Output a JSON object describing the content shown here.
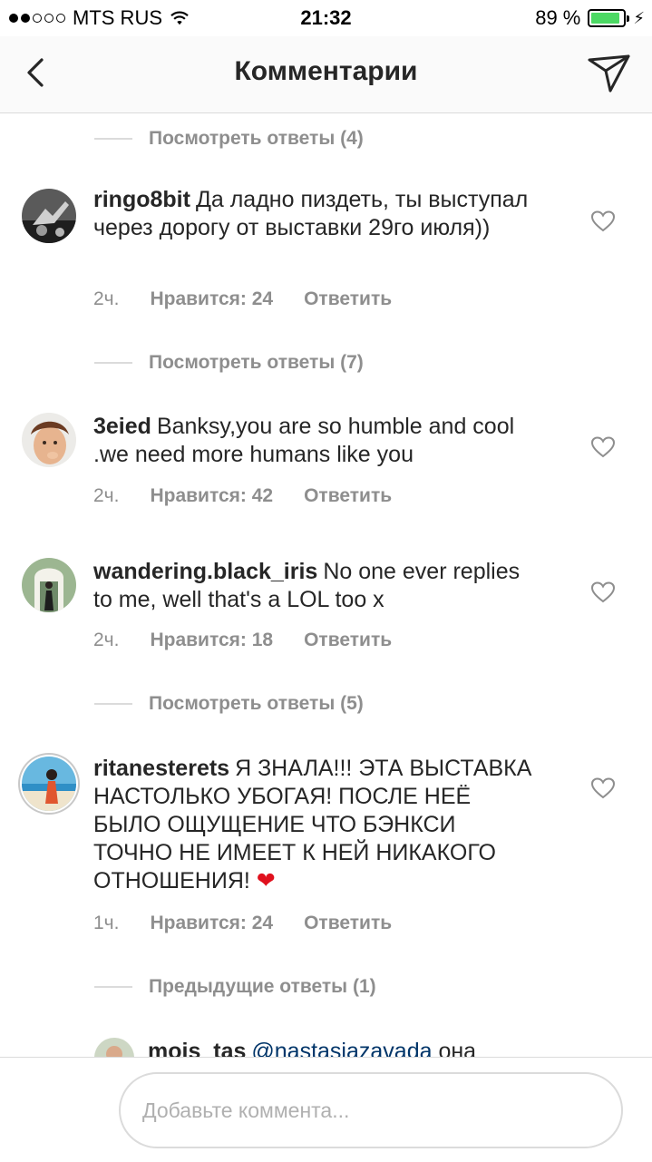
{
  "status_bar": {
    "carrier": "MTS RUS",
    "time": "21:32",
    "battery_percent": "89 %",
    "battery_level": 0.89,
    "signal_bars_filled": 2,
    "signal_bars_total": 5
  },
  "header": {
    "title": "Комментарии",
    "back_icon": "chevron-left-icon",
    "action_icon": "send-icon"
  },
  "threads": [
    {
      "view_replies_label": "Посмотреть ответы (4)"
    },
    {
      "username": "ringo8bit",
      "text": "Да ладно пиздеть, ты выступал через дорогу от выставки 29го июля))",
      "time": "2ч.",
      "likes": "Нравится: 24",
      "reply": "Ответить",
      "view_replies_label": "Посмотреть ответы (7)"
    },
    {
      "username": "3eied",
      "text": "Banksy,you are so humble and cool .we need more humans like you",
      "time": "2ч.",
      "likes": "Нравится: 42",
      "reply": "Ответить"
    },
    {
      "username": "wandering.black_iris",
      "text": "No one ever replies to me, well that's a LOL too x",
      "time": "2ч.",
      "likes": "Нравится: 18",
      "reply": "Ответить",
      "view_replies_label": "Посмотреть ответы (5)"
    },
    {
      "username": "ritanesterets",
      "text": "Я ЗНАЛА!!! ЭТА ВЫСТАВКА НАСТОЛЬКО УБОГАЯ! ПОСЛЕ НЕЁ БЫЛО ОЩУЩЕНИЕ ЧТО БЭНКСИ ТОЧНО НЕ ИМЕЕТ К НЕЙ НИКАКОГО ОТНОШЕНИЯ!",
      "emoji": "❤",
      "time": "1ч.",
      "likes": "Нравится: 24",
      "reply": "Ответить",
      "previous_replies_label": "Предыдущие ответы (1)"
    },
    {
      "username": "mois_tas",
      "mention": "@nastasiazavada",
      "text": "она"
    }
  ],
  "composer": {
    "placeholder": "Добавьте коммента..."
  },
  "colors": {
    "text": "#262626",
    "muted": "#8e8e8e",
    "divider": "#dbdbdb",
    "mention": "#003569",
    "battery": "#4cd964",
    "heart_emoji": "#e0101d"
  }
}
